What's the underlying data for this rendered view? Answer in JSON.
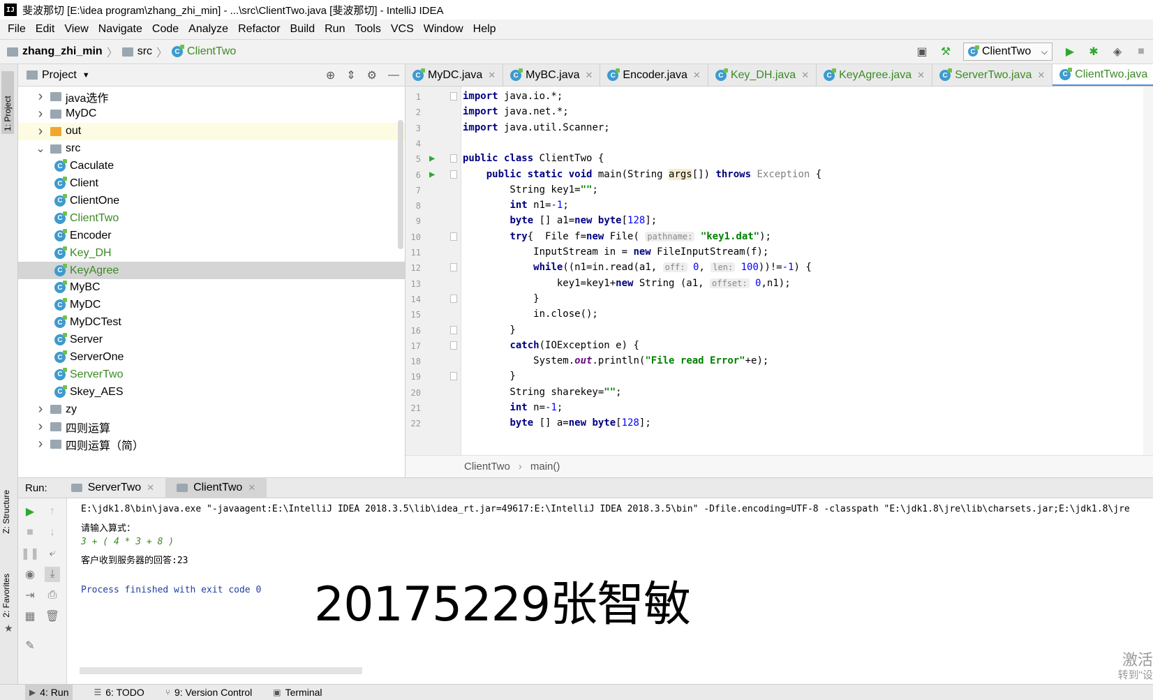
{
  "window": {
    "title": "斐波那切 [E:\\idea program\\zhang_zhi_min] - ...\\src\\ClientTwo.java [斐波那切] - IntelliJ IDEA",
    "app_icon": "IJ"
  },
  "menu": [
    "File",
    "Edit",
    "View",
    "Navigate",
    "Code",
    "Analyze",
    "Refactor",
    "Build",
    "Run",
    "Tools",
    "VCS",
    "Window",
    "Help"
  ],
  "breadcrumb": {
    "project": "zhang_zhi_min",
    "folder": "src",
    "file": "ClientTwo"
  },
  "run_config": {
    "name": "ClientTwo"
  },
  "left_strip": {
    "project_tab": "1: Project",
    "structure_tab": "Z: Structure",
    "favorites_tab": "2: Favorites"
  },
  "project_panel": {
    "title": "Project",
    "rows": [
      {
        "label": "java选作",
        "kind": "folder",
        "depth": 1,
        "expanded": false
      },
      {
        "label": "MyDC",
        "kind": "folder",
        "depth": 1,
        "expanded": false
      },
      {
        "label": "out",
        "kind": "folder-orange",
        "depth": 1,
        "expanded": false
      },
      {
        "label": "src",
        "kind": "folder",
        "depth": 1,
        "expanded": true
      },
      {
        "label": "Caculate",
        "kind": "class",
        "depth": 2
      },
      {
        "label": "Client",
        "kind": "class",
        "depth": 2
      },
      {
        "label": "ClientOne",
        "kind": "class",
        "depth": 2
      },
      {
        "label": "ClientTwo",
        "kind": "class",
        "depth": 2,
        "green": true
      },
      {
        "label": "Encoder",
        "kind": "class",
        "depth": 2
      },
      {
        "label": "Key_DH",
        "kind": "class",
        "depth": 2,
        "green": true
      },
      {
        "label": "KeyAgree",
        "kind": "class",
        "depth": 2,
        "green": true,
        "selected": true
      },
      {
        "label": "MyBC",
        "kind": "class",
        "depth": 2
      },
      {
        "label": "MyDC",
        "kind": "class",
        "depth": 2
      },
      {
        "label": "MyDCTest",
        "kind": "class",
        "depth": 2
      },
      {
        "label": "Server",
        "kind": "class",
        "depth": 2
      },
      {
        "label": "ServerOne",
        "kind": "class",
        "depth": 2
      },
      {
        "label": "ServerTwo",
        "kind": "class",
        "depth": 2,
        "green": true
      },
      {
        "label": "Skey_AES",
        "kind": "class",
        "depth": 2
      },
      {
        "label": "zy",
        "kind": "folder",
        "depth": 1,
        "expanded": false
      },
      {
        "label": "四则运算",
        "kind": "folder",
        "depth": 1,
        "expanded": false
      },
      {
        "label": "四则运算（简）",
        "kind": "folder",
        "depth": 1,
        "expanded": false
      }
    ]
  },
  "editor_tabs": [
    {
      "label": "MyDC.java",
      "active": false,
      "green": false
    },
    {
      "label": "MyBC.java",
      "active": false,
      "green": false
    },
    {
      "label": "Encoder.java",
      "active": false,
      "green": false
    },
    {
      "label": "Key_DH.java",
      "active": false,
      "green": true
    },
    {
      "label": "KeyAgree.java",
      "active": false,
      "green": true
    },
    {
      "label": "ServerTwo.java",
      "active": false,
      "green": true
    },
    {
      "label": "ClientTwo.java",
      "active": true,
      "green": true
    }
  ],
  "code_lines": [
    {
      "n": "1",
      "html": "<span class=\"kw\">import</span> java.io.*;"
    },
    {
      "n": "2",
      "html": "<span class=\"kw\">import</span> java.net.*;"
    },
    {
      "n": "3",
      "html": "<span class=\"kw\">import</span> java.util.Scanner;"
    },
    {
      "n": "4",
      "html": ""
    },
    {
      "n": "5",
      "html": "<span class=\"kw\">public class</span> ClientTwo {",
      "run": true
    },
    {
      "n": "6",
      "html": "    <span class=\"kw\">public static void</span> main(String <span class=\"param\">args</span>[]) <span class=\"kw\">throws</span> <span class=\"gray\">Exception</span> {",
      "run": true
    },
    {
      "n": "7",
      "html": "        String key1=<span class=\"str\">\"\"</span>;"
    },
    {
      "n": "8",
      "html": "        <span class=\"kw\">int</span> n1=<span class=\"num\">-1</span>;"
    },
    {
      "n": "9",
      "html": "        <span class=\"kw\">byte</span> [] a1=<span class=\"kw\">new byte</span>[<span class=\"num\">128</span>];"
    },
    {
      "n": "10",
      "html": "        <span class=\"kw\">try</span>{  File f=<span class=\"kw\">new</span> File( <span class=\"hint\">pathname:</span> <span class=\"str\">\"key1.dat\"</span>);"
    },
    {
      "n": "11",
      "html": "            InputStream in = <span class=\"kw\">new</span> FileInputStream(f);"
    },
    {
      "n": "12",
      "html": "            <span class=\"kw\">while</span>((n1=in.read(a1, <span class=\"hint\">off:</span> <span class=\"num\">0</span>, <span class=\"hint\">len:</span> <span class=\"num\">100</span>))!=<span class=\"num\">-1</span>) {"
    },
    {
      "n": "13",
      "html": "                key1=key1+<span class=\"kw\">new</span> String (a1, <span class=\"hint\">offset:</span> <span class=\"num\">0</span>,n1);"
    },
    {
      "n": "14",
      "html": "            }"
    },
    {
      "n": "15",
      "html": "            in.close();"
    },
    {
      "n": "16",
      "html": "        }"
    },
    {
      "n": "17",
      "html": "        <span class=\"kw\">catch</span>(IOException e) {"
    },
    {
      "n": "18",
      "html": "            System.<span class=\"field\">out</span>.println(<span class=\"str\">\"File read Error\"</span>+e);"
    },
    {
      "n": "19",
      "html": "        }"
    },
    {
      "n": "20",
      "html": "        String sharekey=<span class=\"str\">\"\"</span>;"
    },
    {
      "n": "21",
      "html": "        <span class=\"kw\">int</span> n=<span class=\"num\">-1</span>;"
    },
    {
      "n": "22",
      "html": "        <span class=\"kw\">byte</span> [] a=<span class=\"kw\">new byte</span>[<span class=\"num\">128</span>];"
    }
  ],
  "editor_breadcrumb": {
    "class": "ClientTwo",
    "method": "main()"
  },
  "run_panel": {
    "label": "Run:",
    "tabs": [
      {
        "label": "ServerTwo",
        "active": false
      },
      {
        "label": "ClientTwo",
        "active": true
      }
    ]
  },
  "console": {
    "cmd": "E:\\jdk1.8\\bin\\java.exe \"-javaagent:E:\\IntelliJ IDEA 2018.3.5\\lib\\idea_rt.jar=49617:E:\\IntelliJ IDEA 2018.3.5\\bin\" -Dfile.encoding=UTF-8 -classpath \"E:\\jdk1.8\\jre\\lib\\charsets.jar;E:\\jdk1.8\\jre",
    "prompt": "请输入算式：",
    "input": "3 + ( 4 * 3 + 8 )",
    "reply": "客户收到服务器的回答:23",
    "exit": "Process finished with exit code 0",
    "overlay_text": "20175229张智敏"
  },
  "watermark": {
    "line1": "激活",
    "line2": "转到\"设"
  },
  "bottom_tabs": [
    {
      "label": "4: Run",
      "active": true,
      "icon": "▶"
    },
    {
      "label": "6: TODO",
      "active": false,
      "icon": "☰"
    },
    {
      "label": "9: Version Control",
      "active": false,
      "icon": "⑂"
    },
    {
      "label": "Terminal",
      "active": false,
      "icon": "▣"
    }
  ],
  "colors": {
    "accent_green": "#3b8a24",
    "keyword": "#000080",
    "string": "#008000",
    "tab_underline": "#4a90d9"
  }
}
